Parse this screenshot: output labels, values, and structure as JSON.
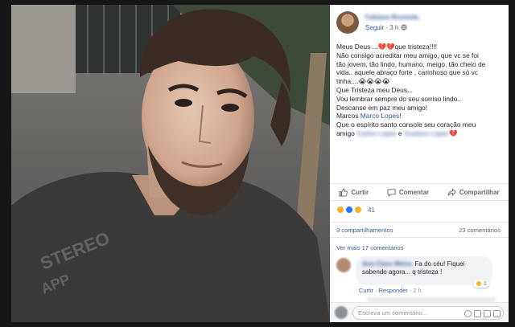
{
  "post": {
    "author": "Fabiana Rosenda",
    "follow": "Seguir",
    "time": "3 h",
    "privacy_icon": "globe-icon",
    "body": {
      "l1a": "Meus Deus ...",
      "l1b": "que tristeza!!!!",
      "l2": "Não consigo acreditar meu amigo, que vc se foi",
      "l3": "tão jovem, tão lindo, humano, meigo, tão cheio de",
      "l4": "vida.. aquele abraço forte , carinhoso que só vc",
      "l5": "tinha....",
      "l6": "Que Tristeza meu Deus...",
      "l7": "Vou lembrar sempre do seu sorriso lindo..",
      "l8": "Descanse em paz meu amigo!",
      "l9a": "Marcos ",
      "l9link": "Marco Lopes",
      "l9b": "!",
      "l10": "Que o espírito santo console seu coração meu",
      "l11a": "amigo ",
      "l11name1": "Carlos Lopes",
      "l11and": " e ",
      "l11name2": "Gustavo Lopes"
    }
  },
  "actions": {
    "like": "Curtir",
    "comment": "Comentar",
    "share": "Compartilhar"
  },
  "reactions": {
    "count": "41"
  },
  "stats": {
    "shares": "3 compartilhamentos",
    "comments": "23 comentários"
  },
  "comments": {
    "more": "Ver mais 17 comentários",
    "first": {
      "name": "Ana Clara Weiss",
      "text_1": "Fa do céu! Fiquei",
      "text_2": "sabendo agora... q tristeza !",
      "reaction_count": "1",
      "like": "Curtir",
      "reply": "Responder",
      "time": "2 h"
    }
  },
  "compose": {
    "placeholder": "Escreva um comentário..."
  },
  "colors": {
    "link": "#385898",
    "text": "#1d2129",
    "muted": "#606770",
    "background": "#161616"
  }
}
